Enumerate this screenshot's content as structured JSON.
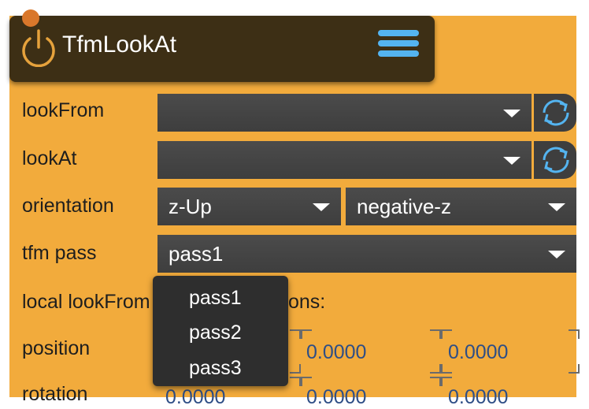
{
  "header": {
    "title": "TfmLookAt",
    "power_icon": "power-icon",
    "menu_icon": "hamburger-menu-icon"
  },
  "rows": {
    "lookFrom": {
      "label": "lookFrom",
      "value": ""
    },
    "lookAt": {
      "label": "lookAt",
      "value": ""
    },
    "orientation": {
      "label": "orientation",
      "up_value": "z-Up",
      "axis_value": "negative-z"
    },
    "tfm_pass": {
      "label": "tfm pass",
      "value": "pass1"
    },
    "local_section": {
      "label_left": "local lookFrom",
      "label_right": "ons:"
    },
    "position": {
      "label": "position",
      "values": [
        "0.0000",
        "0.0000"
      ]
    },
    "rotation": {
      "label": "rotation",
      "values": [
        "0.0000",
        "0.0000",
        "0.0000"
      ]
    }
  },
  "dropdown": {
    "options": [
      "pass1",
      "pass2",
      "pass3"
    ]
  },
  "colors": {
    "panel": "#f2ab3c",
    "header": "#3d2f15",
    "accent": "#54b4f0",
    "dot": "#d9772b"
  }
}
